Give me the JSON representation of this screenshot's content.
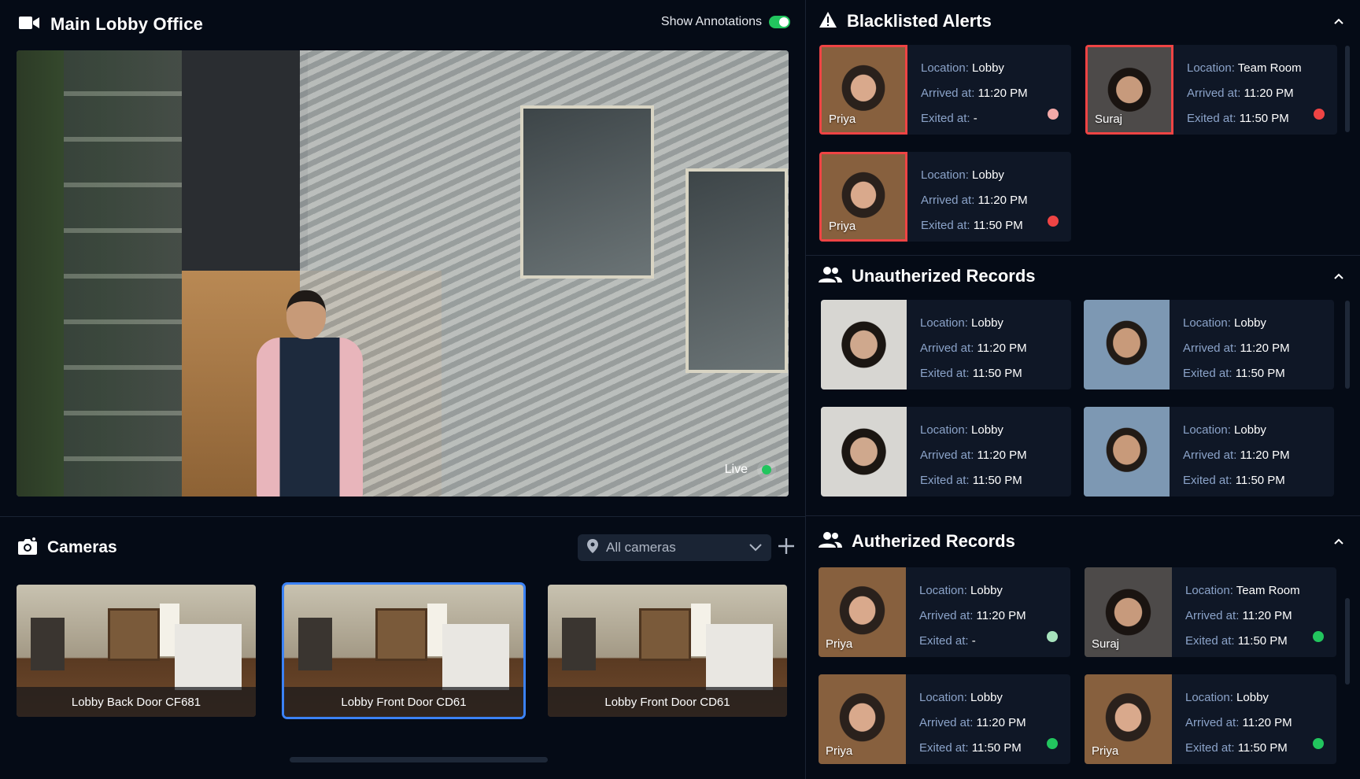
{
  "main_feed": {
    "title": "Main Lobby Office",
    "show_annotations_label": "Show Annotations",
    "show_annotations_on": true,
    "live_label": "Live",
    "camera_icon": "video-camera-icon"
  },
  "cameras": {
    "title": "Cameras",
    "icon": "camera-icon",
    "filter": {
      "icon": "map-pin-icon",
      "selected": "All cameras"
    },
    "add_icon": "plus-icon",
    "tiles": [
      {
        "label": "Lobby Back Door CF681",
        "selected": false
      },
      {
        "label": "Lobby Front Door CD61",
        "selected": true
      },
      {
        "label": "Lobby Front Door CD61",
        "selected": false
      }
    ]
  },
  "blacklisted": {
    "title": "Blacklisted Alerts",
    "icon": "warning-icon",
    "records": [
      {
        "name": "Priya",
        "location": "Lobby",
        "arrived": "11:20 PM",
        "exited": "-",
        "status_color": "#f4a9a8"
      },
      {
        "name": "Suraj",
        "location": "Team Room",
        "arrived": "11:20 PM",
        "exited": "11:50 PM",
        "status_color": "#ef4444"
      },
      {
        "name": "Priya",
        "location": "Lobby",
        "arrived": "11:20 PM",
        "exited": "11:50 PM",
        "status_color": "#ef4444"
      }
    ]
  },
  "unauthorized": {
    "title": "Unautherized Records",
    "icon": "users-icon",
    "records": [
      {
        "location": "Lobby",
        "arrived": "11:20 PM",
        "exited": "11:50 PM"
      },
      {
        "location": "Lobby",
        "arrived": "11:20 PM",
        "exited": "11:50 PM"
      },
      {
        "location": "Lobby",
        "arrived": "11:20 PM",
        "exited": "11:50 PM"
      },
      {
        "location": "Lobby",
        "arrived": "11:20 PM",
        "exited": "11:50 PM"
      }
    ]
  },
  "authorized": {
    "title": "Autherized Records",
    "icon": "users-icon",
    "records": [
      {
        "name": "Priya",
        "location": "Lobby",
        "arrived": "11:20 PM",
        "exited": "-",
        "status_color": "#a7e3bd"
      },
      {
        "name": "Suraj",
        "location": "Team Room",
        "arrived": "11:20 PM",
        "exited": "11:50 PM",
        "status_color": "#22c55e"
      },
      {
        "name": "Priya",
        "location": "Lobby",
        "arrived": "11:20 PM",
        "exited": "11:50 PM",
        "status_color": "#22c55e"
      },
      {
        "name": "Priya",
        "location": "Lobby",
        "arrived": "11:20 PM",
        "exited": "11:50 PM",
        "status_color": "#22c55e"
      }
    ]
  },
  "labels": {
    "location": "Location: ",
    "arrived": "Arrived at: ",
    "exited": "Exited at: "
  }
}
